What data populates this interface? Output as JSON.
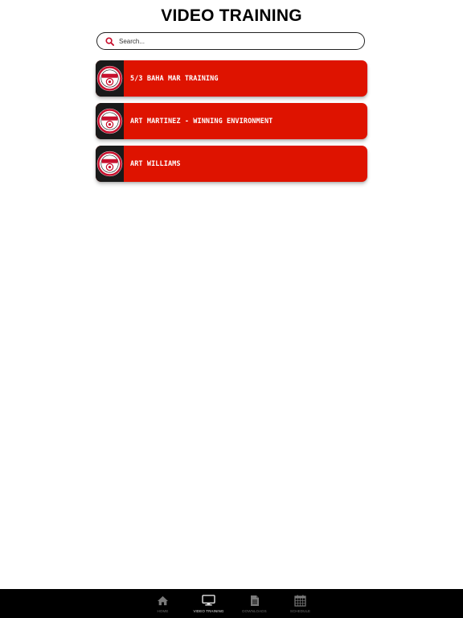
{
  "header": {
    "title": "VIDEO TRAINING"
  },
  "search": {
    "placeholder": "Search...",
    "value": "",
    "icon": "search-icon"
  },
  "colors": {
    "accent_red": "#de1300",
    "search_icon": "#c8102e",
    "tabbar_bg": "#000000",
    "active_tab": "#e6e6e6",
    "inactive_tab": "#6f6f6f"
  },
  "videos": [
    {
      "title": "5/3 BAHA MAR TRAINING"
    },
    {
      "title": "ART MARTINEZ - WINNING ENVIRONMENT"
    },
    {
      "title": "ART WILLIAMS"
    }
  ],
  "tabbar": {
    "tabs": [
      {
        "label": "HOME",
        "icon": "home-icon",
        "active": false
      },
      {
        "label": "VIDEO TRAINING",
        "icon": "monitor-icon",
        "active": true
      },
      {
        "label": "DOWNLOADS",
        "icon": "document-icon",
        "active": false
      },
      {
        "label": "SCHEDULE",
        "icon": "calendar-icon",
        "active": false
      }
    ]
  }
}
